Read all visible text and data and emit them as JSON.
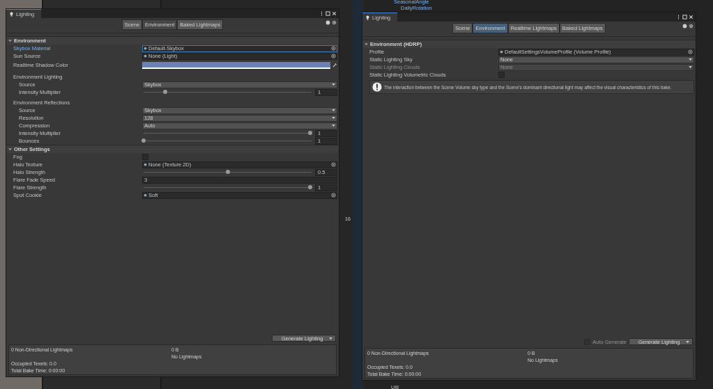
{
  "background": {
    "hierarchy_items": [
      {
        "label": "SeasonalAngle"
      },
      {
        "label": "DailyRotation"
      }
    ],
    "scene_badge": "16",
    "project_items": [
      {
        "label": "Util"
      }
    ]
  },
  "windows": [
    {
      "title": "Lighting",
      "focused": false,
      "tabs": [
        {
          "label": "Scene",
          "selected": false
        },
        {
          "label": "Environment",
          "selected": true
        },
        {
          "label": "Baked Lightmaps",
          "selected": false
        }
      ],
      "sections": [
        {
          "title": "Environment",
          "expanded": true,
          "rows": [
            {
              "kind": "object",
              "label": "Skybox Material",
              "value": "Default-Skybox",
              "focused": true
            },
            {
              "kind": "object",
              "label": "Sun Source",
              "value": "None (Light)",
              "focused": false
            },
            {
              "kind": "color",
              "label": "Realtime Shadow Color",
              "color": "#6b80b3"
            },
            {
              "kind": "group",
              "label": "Environment Lighting",
              "children": [
                {
                  "kind": "dropdown",
                  "label": "Source",
                  "value": "Skybox"
                },
                {
                  "kind": "slider",
                  "label": "Intensity Multiplier",
                  "level": 0.13,
                  "value": "1"
                }
              ]
            },
            {
              "kind": "group",
              "label": "Environment Reflections",
              "children": [
                {
                  "kind": "dropdown",
                  "label": "Source",
                  "value": "Skybox"
                },
                {
                  "kind": "dropdown",
                  "label": "Resolution",
                  "value": "128"
                },
                {
                  "kind": "dropdown",
                  "label": "Compression",
                  "value": "Auto"
                },
                {
                  "kind": "slider",
                  "label": "Intensity Multiplier",
                  "level": 0.99,
                  "value": "1"
                },
                {
                  "kind": "slider",
                  "label": "Bounces",
                  "level": 0,
                  "value": "1"
                }
              ]
            }
          ]
        },
        {
          "title": "Other Settings",
          "expanded": true,
          "rows": [
            {
              "kind": "checkbox",
              "label": "Fog",
              "checked": false
            },
            {
              "kind": "object",
              "label": "Halo Texture",
              "value": "None (Texture 2D)",
              "focused": false
            },
            {
              "kind": "slider",
              "label": "Halo Strength",
              "level": 0.5,
              "value": "0.5"
            },
            {
              "kind": "number",
              "label": "Flare Fade Speed",
              "value": "3"
            },
            {
              "kind": "slider",
              "label": "Flare Strength",
              "level": 0.99,
              "value": "1"
            },
            {
              "kind": "object",
              "label": "Spot Cookie",
              "value": "Soft",
              "focused": false
            }
          ]
        }
      ],
      "generate": {
        "label": "Generate Lighting"
      },
      "stats": {
        "lightmaps": "0 Non-Directional Lightmaps",
        "size": "0 B",
        "status": "No Lightmaps",
        "texels": "Occupied Texels: 0.0",
        "bake_time": "Total Bake Time: 0:00:00"
      }
    },
    {
      "title": "Lighting",
      "focused": true,
      "tabs": [
        {
          "label": "Scene",
          "selected": false
        },
        {
          "label": "Environment",
          "selected": true
        },
        {
          "label": "Realtime Lightmaps",
          "selected": false
        },
        {
          "label": "Baked Lightmaps",
          "selected": false
        }
      ],
      "sections": [
        {
          "title": "Environment (HDRP)",
          "expanded": true,
          "rows": [
            {
              "kind": "object",
              "label": "Profile",
              "value": "DefaultSettingsVolumeProfile (Volume Profile)",
              "focused": false
            },
            {
              "kind": "dropdown",
              "label": "Static Lighting Sky",
              "value": "None",
              "disabled": false
            },
            {
              "kind": "dropdown",
              "label": "Static Lighting Clouds",
              "value": "None",
              "disabled": true
            },
            {
              "kind": "checkbox",
              "label": "Static Lighting Volumetric Clouds",
              "checked": false
            },
            {
              "kind": "helpbox",
              "text": "The interaction between the Scene Volume sky type and the Scene's dominant directional light may affect the visual characteristics of this bake."
            }
          ]
        }
      ],
      "generate": {
        "label": "Generate Lighting",
        "auto_generate": {
          "label": "Auto Generate",
          "checked": false
        }
      },
      "stats": {
        "lightmaps": "0 Non-Directional Lightmaps",
        "size": "0 B",
        "status": "No Lightmaps",
        "texels": "Occupied Texels: 0.0",
        "bake_time": "Total Bake Time: 0:00:00"
      }
    }
  ]
}
